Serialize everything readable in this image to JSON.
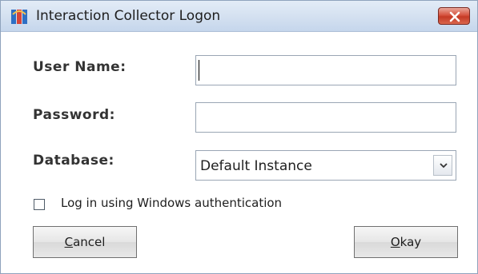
{
  "window": {
    "title": "Interaction Collector Logon",
    "app_icon": "collector-app-icon",
    "close_icon": "close-icon"
  },
  "form": {
    "username_label": "User Name:",
    "username_value": "",
    "password_label": "Password:",
    "password_value": "",
    "database_label": "Database:",
    "database_selected": "Default Instance",
    "database_arrow_icon": "chevron-down-icon",
    "windows_auth_label": "Log in using Windows authentication",
    "windows_auth_checked": false
  },
  "buttons": {
    "cancel_mnemonic": "C",
    "cancel_rest": "ancel",
    "okay_mnemonic": "O",
    "okay_rest": "kay"
  },
  "colors": {
    "titlebar": "#d3e0f0",
    "close_button": "#d6533f",
    "window_border": "#8fa3bd"
  }
}
